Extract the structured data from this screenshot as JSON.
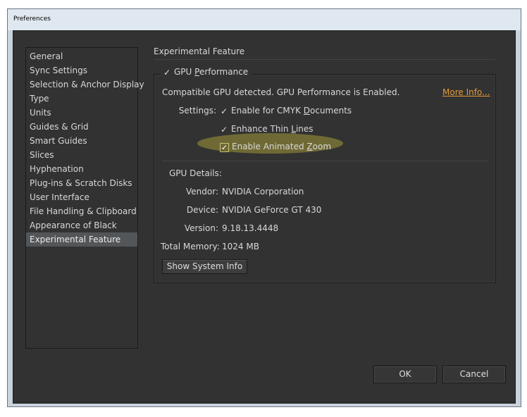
{
  "window": {
    "title": "Preferences"
  },
  "sidebar": {
    "items": [
      {
        "label": "General"
      },
      {
        "label": "Sync Settings"
      },
      {
        "label": "Selection & Anchor Display"
      },
      {
        "label": "Type"
      },
      {
        "label": "Units"
      },
      {
        "label": "Guides & Grid"
      },
      {
        "label": "Smart Guides"
      },
      {
        "label": "Slices"
      },
      {
        "label": "Hyphenation"
      },
      {
        "label": "Plug-ins & Scratch Disks"
      },
      {
        "label": "User Interface"
      },
      {
        "label": "File Handling & Clipboard"
      },
      {
        "label": "Appearance of Black"
      },
      {
        "label": "Experimental Feature",
        "selected": true
      }
    ]
  },
  "main": {
    "section_title": "Experimental Feature",
    "gpu_group": {
      "checkbox_label_pre": "GPU ",
      "checkbox_label_ul": "P",
      "checkbox_label_post": "erformance",
      "checked": true,
      "status_text": "Compatible GPU detected. GPU Performance is Enabled.",
      "more_info_link": "More Info...",
      "settings_label": "Settings:",
      "options": [
        {
          "pre": "Enable for CMYK ",
          "ul": "D",
          "post": "ocuments",
          "checked": true
        },
        {
          "pre": "Enhance Thin ",
          "ul": "L",
          "post": "ines",
          "checked": true
        },
        {
          "pre": "Enable Animated ",
          "ul": "Z",
          "post": "oom",
          "checked": true,
          "highlighted": true
        }
      ],
      "details_label": "GPU Details:",
      "vendor_label": "Vendor:",
      "vendor_value": "NVIDIA Corporation",
      "device_label": "Device:",
      "device_value": "NVIDIA GeForce GT 430",
      "version_label": "Version:",
      "version_value": "9.18.13.4448",
      "memory_label": "Total Memory:",
      "memory_value": "1024 MB",
      "system_info_button": "Show System Info"
    }
  },
  "footer": {
    "ok_label": "OK",
    "cancel_label": "Cancel"
  },
  "colors": {
    "panel_bg": "#323232",
    "link": "#e49a3a",
    "highlight": "#6f6a35",
    "selected_item": "#535659"
  }
}
